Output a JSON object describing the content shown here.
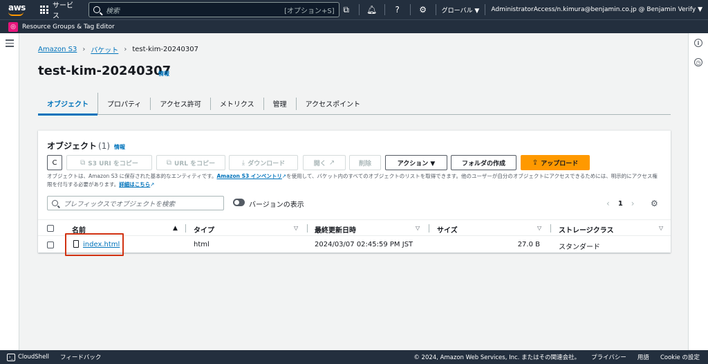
{
  "topnav": {
    "logo_text": "aws",
    "services_label": "サービス",
    "search_placeholder": "検索",
    "search_shortcut": "[オプション+S]",
    "region": "グローバル ▼",
    "account": "AdministratorAccess/n.kimura@benjamin.co.jp @ Benjamin Verify ▼"
  },
  "subnav": {
    "app_label": "Resource Groups & Tag Editor"
  },
  "breadcrumb": {
    "items": [
      "Amazon S3",
      "バケット"
    ],
    "current": "test-kim-20240307"
  },
  "page": {
    "title": "test-kim-20240307",
    "info": "情報"
  },
  "tabs": [
    "オブジェクト",
    "プロパティ",
    "アクセス許可",
    "メトリクス",
    "管理",
    "アクセスポイント"
  ],
  "objects_panel": {
    "title": "オブジェクト",
    "count": "(1)",
    "info": "情報",
    "buttons": {
      "refresh_icon": "C",
      "copy_s3_uri": "S3 URI をコピー",
      "copy_url": "URL をコピー",
      "download": "ダウンロード",
      "open": "開く",
      "delete": "削除",
      "actions": "アクション ▼",
      "create_folder": "フォルダの作成",
      "upload": "アップロード"
    },
    "description_pre": "オブジェクトは、Amazon S3 に保存された基本的なエンティティです。",
    "description_link1": "Amazon S3 インベントリ",
    "description_mid": "を使用して、バケット内のすべてのオブジェクトのリストを取得できます。他のユーザーが自分のオブジェクトにアクセスできるためには、明示的にアクセス権限を付与する必要があります。",
    "description_link2": "詳細はこちら",
    "filter_placeholder": "プレフィックスでオブジェクトを検索",
    "toggle_label": "バージョンの表示",
    "page_number": "1",
    "columns": [
      "名前",
      "タイプ",
      "最終更新日時",
      "サイズ",
      "ストレージクラス"
    ],
    "rows": [
      {
        "name": "index.html",
        "type": "html",
        "last_modified": "2024/03/07 02:45:59 PM JST",
        "size": "27.0 B",
        "storage_class": "スタンダード"
      }
    ]
  },
  "footer": {
    "cloudshell": "CloudShell",
    "feedback": "フィードバック",
    "copyright": "© 2024, Amazon Web Services, Inc. またはその関連会社。",
    "privacy": "プライバシー",
    "terms": "用語",
    "cookie": "Cookie の設定"
  },
  "colors": {
    "nav_bg": "#232f3e",
    "link": "#0073bb",
    "upload_button": "#ff9900",
    "highlight_box": "#d13212",
    "rg_icon": "#e7157b"
  }
}
